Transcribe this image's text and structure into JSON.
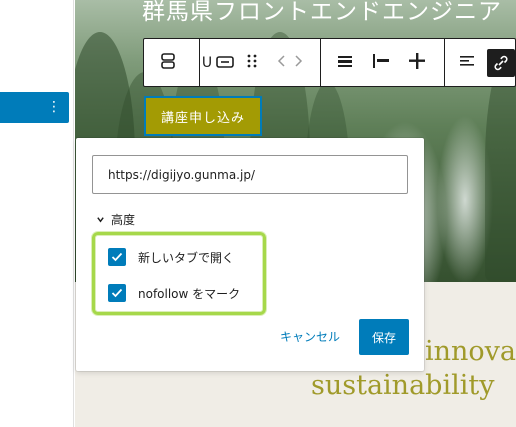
{
  "hero": {
    "title": "群馬県フロントエンドエンジニア"
  },
  "cta": {
    "label": "講座申し込み"
  },
  "link_popover": {
    "url": "https://digijyo.gunma.jp/",
    "advanced_label": "高度",
    "options": [
      {
        "label": "新しいタブで開く",
        "checked": true
      },
      {
        "label": "nofollow をマーク",
        "checked": true
      }
    ],
    "cancel_label": "キャンセル",
    "save_label": "保存"
  },
  "below_text": {
    "line1": "innova",
    "line2": "sustainability"
  },
  "toolbar": {
    "partial_text": "U",
    "icons": [
      "block-type-icon",
      "button-icon",
      "drag-handle-icon",
      "move-arrows-icon",
      "justify-icon",
      "align-icon",
      "add-icon",
      "text-align-icon",
      "unlink-icon"
    ]
  },
  "colors": {
    "accent": "#007cba",
    "cta": "#a39b04",
    "highlight": "#a6d84a",
    "serif_text": "#a09a2a"
  }
}
